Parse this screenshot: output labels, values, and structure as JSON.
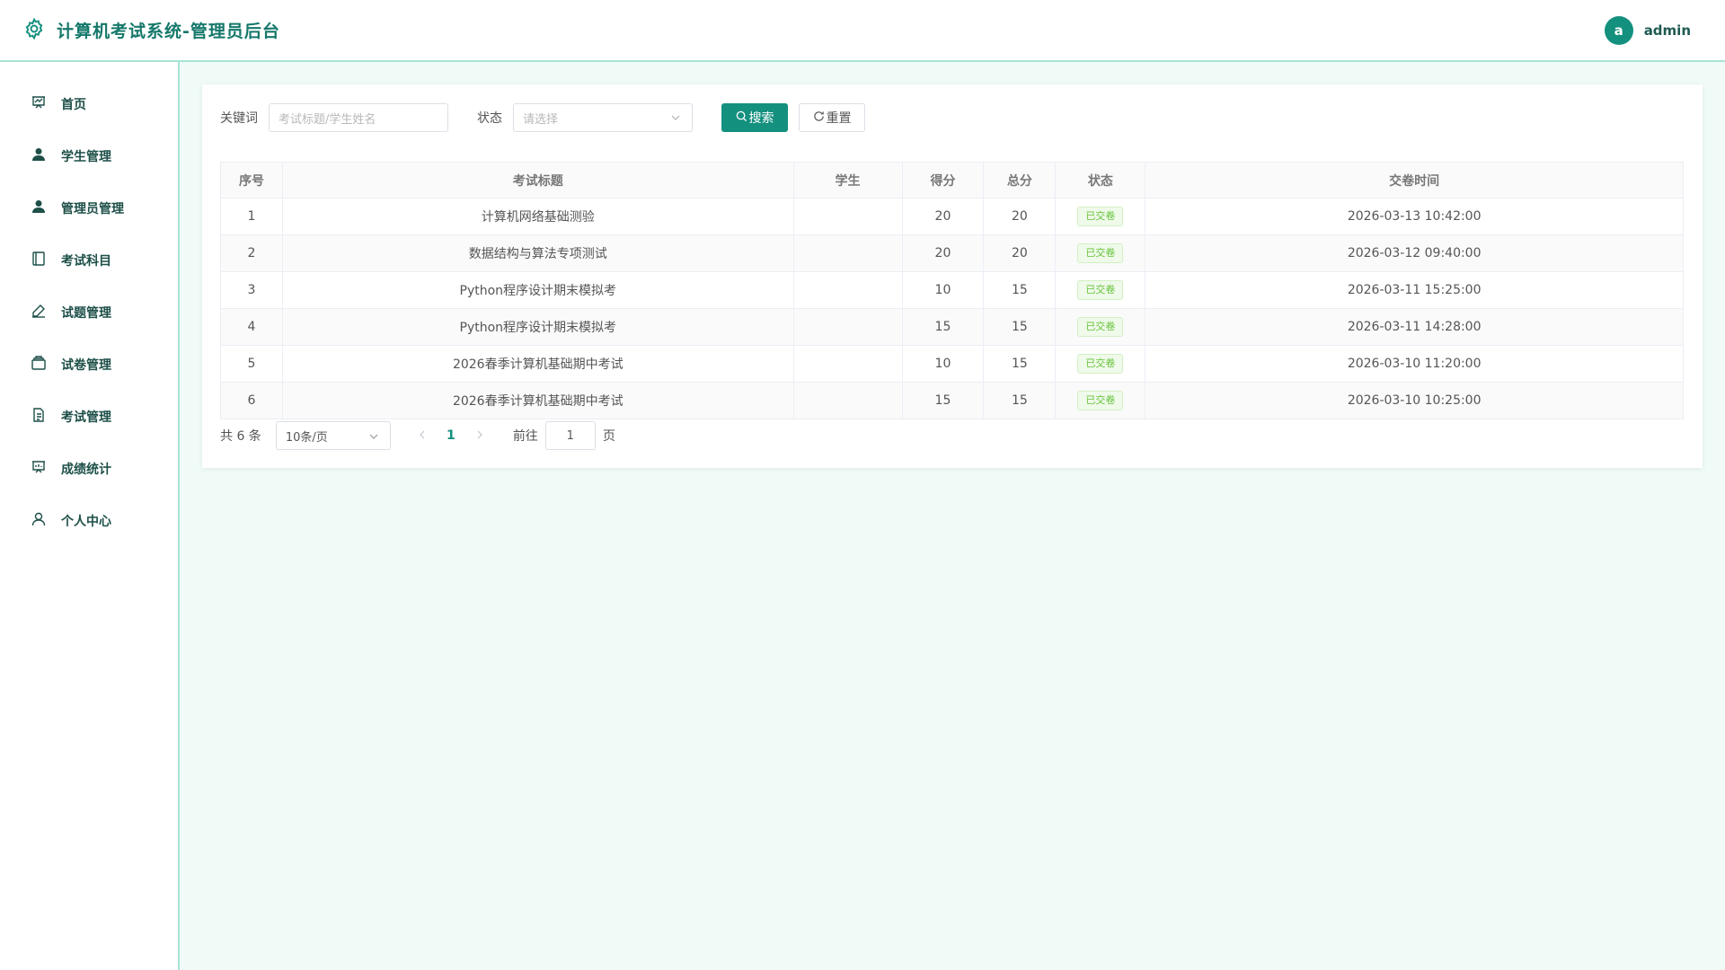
{
  "header": {
    "title": "计算机考试系统-管理员后台",
    "avatar_letter": "a",
    "username": "admin",
    "accent_color": "#14907f"
  },
  "sidebar": {
    "items": [
      {
        "label": "首页",
        "icon": "presentation-chart-icon"
      },
      {
        "label": "学生管理",
        "icon": "user-icon"
      },
      {
        "label": "管理员管理",
        "icon": "user-icon"
      },
      {
        "label": "考试科目",
        "icon": "notebook-icon"
      },
      {
        "label": "试题管理",
        "icon": "edit-pen-icon"
      },
      {
        "label": "试卷管理",
        "icon": "wallet-icon"
      },
      {
        "label": "考试管理",
        "icon": "document-icon"
      },
      {
        "label": "成绩统计",
        "icon": "data-board-icon"
      },
      {
        "label": "个人中心",
        "icon": "user-outline-icon"
      }
    ]
  },
  "filters": {
    "keyword_label": "关键词",
    "keyword_placeholder": "考试标题/学生姓名",
    "status_label": "状态",
    "status_placeholder": "请选择",
    "search_label": "搜索",
    "reset_label": "重置"
  },
  "table": {
    "headers": [
      "序号",
      "考试标题",
      "学生",
      "得分",
      "总分",
      "状态",
      "交卷时间"
    ],
    "rows": [
      {
        "index": "1",
        "title": "计算机网络基础测验",
        "student": "",
        "score": "20",
        "total": "20",
        "status": "已交卷",
        "time": "2026-03-13 10:42:00"
      },
      {
        "index": "2",
        "title": "数据结构与算法专项测试",
        "student": "",
        "score": "20",
        "total": "20",
        "status": "已交卷",
        "time": "2026-03-12 09:40:00"
      },
      {
        "index": "3",
        "title": "Python程序设计期末模拟考",
        "student": "",
        "score": "10",
        "total": "15",
        "status": "已交卷",
        "time": "2026-03-11 15:25:00"
      },
      {
        "index": "4",
        "title": "Python程序设计期末模拟考",
        "student": "",
        "score": "15",
        "total": "15",
        "status": "已交卷",
        "time": "2026-03-11 14:28:00"
      },
      {
        "index": "5",
        "title": "2026春季计算机基础期中考试",
        "student": "",
        "score": "10",
        "total": "15",
        "status": "已交卷",
        "time": "2026-03-10 11:20:00"
      },
      {
        "index": "6",
        "title": "2026春季计算机基础期中考试",
        "student": "",
        "score": "15",
        "total": "15",
        "status": "已交卷",
        "time": "2026-03-10 10:25:00"
      }
    ]
  },
  "pagination": {
    "total_text": "共 6 条",
    "page_size": "10条/页",
    "current_page": "1",
    "goto_label": "前往",
    "goto_value": "1",
    "page_unit": "页"
  }
}
